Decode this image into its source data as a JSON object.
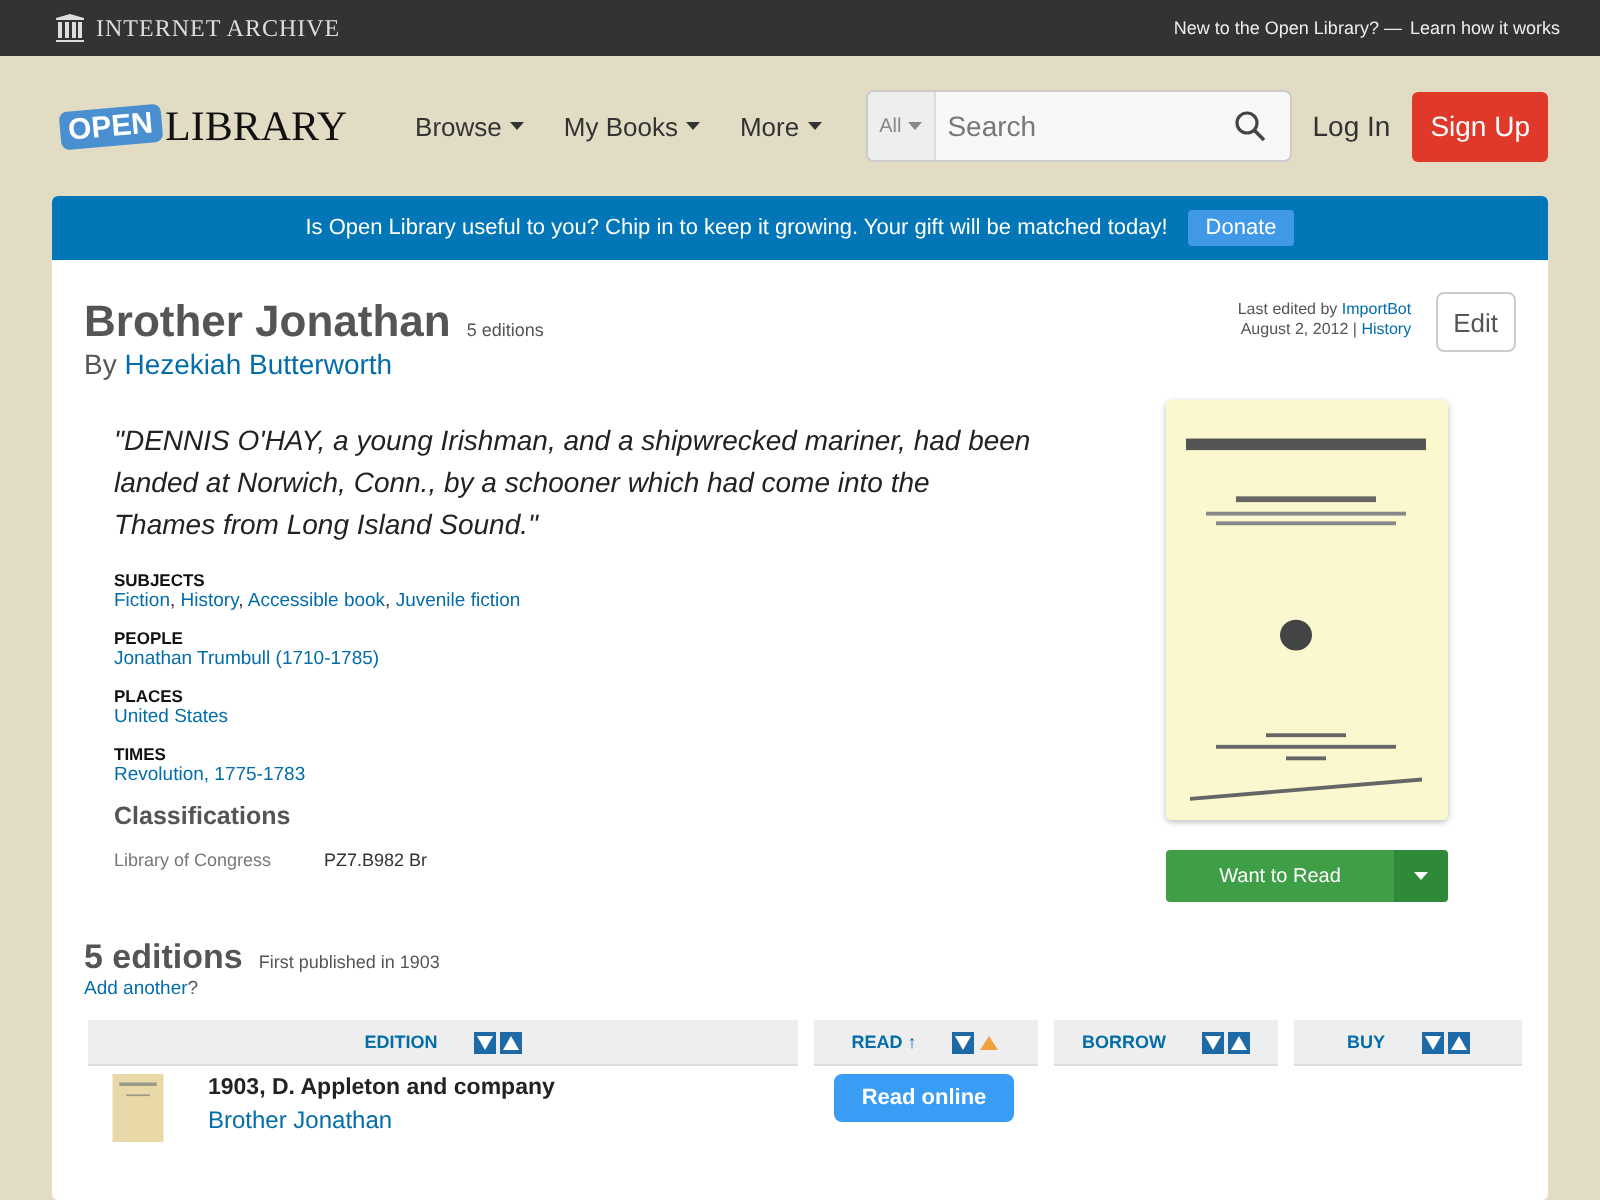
{
  "top_bar": {
    "brand": "INTERNET ARCHIVE",
    "prompt": "New to the Open Library? —",
    "link": "Learn how it works"
  },
  "header": {
    "logo_tag": "OPEN",
    "logo_word": "LIBRARY",
    "nav": [
      {
        "label": "Browse"
      },
      {
        "label": "My Books"
      },
      {
        "label": "More"
      }
    ],
    "search": {
      "scope": "All",
      "placeholder": "Search"
    },
    "login": "Log In",
    "signup": "Sign Up"
  },
  "banner": {
    "text": "Is Open Library useful to you? Chip in to keep it growing. Your gift will be matched today!",
    "button": "Donate"
  },
  "book": {
    "title": "Brother Jonathan",
    "editions_count": "5 editions",
    "by": "By",
    "author": "Hezekiah Butterworth",
    "edited_prefix": "Last edited by",
    "edited_by": "ImportBot",
    "edited_date": "August 2, 2012 |",
    "history": "History",
    "edit": "Edit",
    "quote": "\"DENNIS O'HAY, a young Irishman, and a shipwrecked mariner, had been landed at Norwich, Conn., by a schooner which had come into the Thames from Long Island Sound.\"",
    "facets": [
      {
        "heading": "SUBJECTS",
        "separator": ",",
        "links": [
          "Fiction",
          "History",
          "Accessible book",
          "Juvenile fiction"
        ]
      },
      {
        "heading": "PEOPLE",
        "links": [
          "Jonathan Trumbull (1710-1785)"
        ]
      },
      {
        "heading": "PLACES",
        "links": [
          "United States"
        ]
      },
      {
        "heading": "TIMES",
        "links": [
          "Revolution, 1775-1783"
        ]
      }
    ],
    "classifications": {
      "heading": "Classifications",
      "rows": [
        {
          "label": "Library of Congress",
          "value": "PZ7.B982 Br"
        }
      ]
    },
    "want_to_read": "Want to Read"
  },
  "editions": {
    "heading": "5 editions",
    "first_published": "First published in 1903",
    "add_link": "Add another",
    "add_suffix": "?",
    "columns": [
      {
        "label": "EDITION",
        "active": false
      },
      {
        "label": "READ ↑",
        "active": true
      },
      {
        "label": "BORROW",
        "active": false
      },
      {
        "label": "BUY",
        "active": false
      }
    ],
    "rows": [
      {
        "title": "1903, D. Appleton and company",
        "link": "Brother Jonathan",
        "read_button": "Read online"
      }
    ]
  }
}
